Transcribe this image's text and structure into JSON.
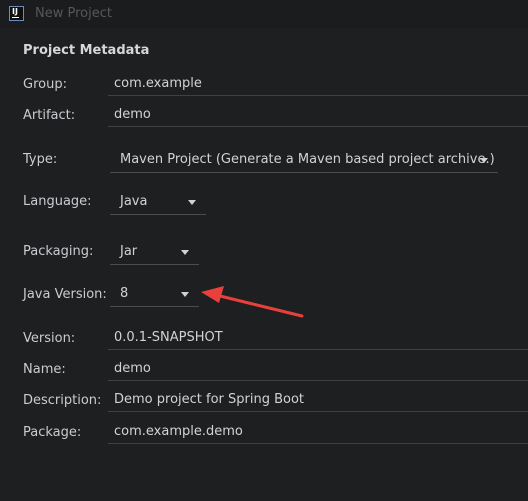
{
  "window": {
    "title": "New Project",
    "app_icon": "intellij-idea-icon"
  },
  "section": {
    "title": "Project Metadata"
  },
  "fields": {
    "group": {
      "label": "Group:",
      "value": "com.example"
    },
    "artifact": {
      "label": "Artifact:",
      "value": "demo"
    },
    "type": {
      "label": "Type:",
      "value": "Maven Project (Generate a Maven based project archive.)"
    },
    "language": {
      "label": "Language:",
      "value": "Java"
    },
    "packaging": {
      "label": "Packaging:",
      "value": "Jar"
    },
    "java_version": {
      "label": "Java Version:",
      "value": "8"
    },
    "version": {
      "label": "Version:",
      "value": "0.0.1-SNAPSHOT"
    },
    "name": {
      "label": "Name:",
      "value": "demo"
    },
    "description": {
      "label": "Description:",
      "value": "Demo project for Spring Boot"
    },
    "package": {
      "label": "Package:",
      "value": "com.example.demo"
    }
  },
  "colors": {
    "annotation_arrow": "#e8413c",
    "background": "#1e1f20"
  }
}
